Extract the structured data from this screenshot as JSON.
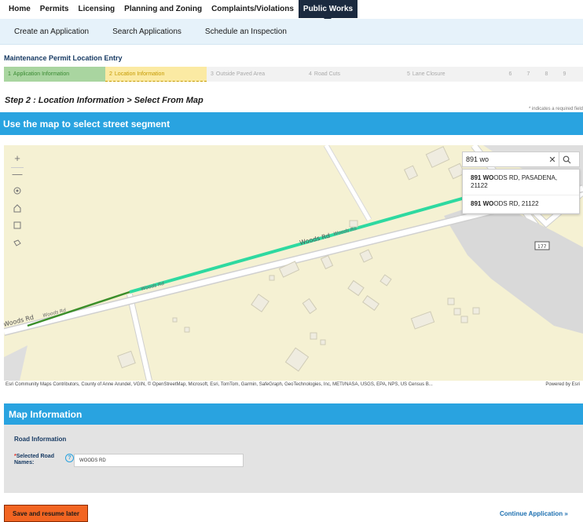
{
  "top_nav": {
    "items": [
      {
        "label": "Home"
      },
      {
        "label": "Permits"
      },
      {
        "label": "Licensing"
      },
      {
        "label": "Planning and Zoning"
      },
      {
        "label": "Complaints/Violations"
      },
      {
        "label": "Public Works",
        "active": true
      }
    ]
  },
  "sub_nav": {
    "items": [
      {
        "label": "Create an Application"
      },
      {
        "label": "Search Applications"
      },
      {
        "label": "Schedule an Inspection"
      }
    ]
  },
  "page": {
    "heading": "Maintenance Permit Location Entry",
    "step_title": "Step 2 : Location Information > Select From Map",
    "required_note": "* indicates a required field"
  },
  "steps": [
    {
      "num": "1",
      "label": "Application Information",
      "state": "done"
    },
    {
      "num": "2",
      "label": "Location Information",
      "state": "current"
    },
    {
      "num": "3",
      "label": "Outside Paved Area",
      "state": "upcoming"
    },
    {
      "num": "4",
      "label": "Road Cuts",
      "state": "upcoming"
    },
    {
      "num": "5",
      "label": "Lane Closure",
      "state": "upcoming"
    },
    {
      "num": "6",
      "label": "",
      "state": "upcoming"
    },
    {
      "num": "7",
      "label": "",
      "state": "upcoming"
    },
    {
      "num": "8",
      "label": "",
      "state": "upcoming"
    },
    {
      "num": "9",
      "label": "",
      "state": "upcoming"
    }
  ],
  "map_banner": "Use the map to select street segment",
  "map": {
    "road_labels": [
      "Woods Rd",
      "Woods Rd",
      "Woods Rd",
      "Woods Rd",
      "Woods Rd"
    ],
    "route_shield": "177",
    "search": {
      "value": "891 wo",
      "suggestions": [
        {
          "match": "891 WO",
          "rest": "ODS RD, PASADENA, 21122"
        },
        {
          "match": "891 WO",
          "rest": "ODS RD, 21122"
        }
      ]
    },
    "attribution": "Esri Community Maps Contributors, County of Anne Arundel, VGIN, © OpenStreetMap, Microsoft, Esri, TomTom, Garmin, SafeGraph, GeoTechnologies, Inc, METI/NASA, USGS, EPA, NPS, US Census B...",
    "powered_by": "Powered by Esri",
    "tools": [
      "zoom-in-icon",
      "zoom-out-icon",
      "locate-icon",
      "home-icon",
      "select-rectangle-icon",
      "select-lasso-icon"
    ]
  },
  "map_info": {
    "header": "Map Information",
    "subheading": "Road Information",
    "field_label": "Selected Road Names:",
    "required_marker": "*",
    "field_value": "WOODS RD"
  },
  "actions": {
    "save_label": "Save and resume later",
    "continue_label": "Continue Application »"
  },
  "colors": {
    "nav_active": "#1b2a3f",
    "accent_blue": "#29a3e0",
    "step_done": "#a9d5a0",
    "step_current": "#fbeaa3",
    "selected_segment": "#2ed9a0",
    "save_button": "#f26522"
  }
}
